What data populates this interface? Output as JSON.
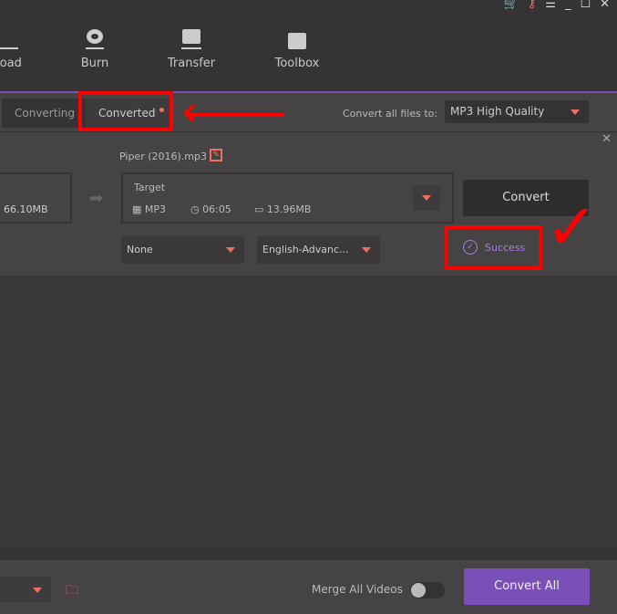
{
  "window_controls": [
    "cart-icon",
    "key-icon",
    "menu-icon",
    "minimize-icon",
    "maximize-icon",
    "close-icon"
  ],
  "nav": [
    {
      "label": "load",
      "icon": "download-icon"
    },
    {
      "label": "Burn",
      "icon": "disc-icon"
    },
    {
      "label": "Transfer",
      "icon": "transfer-icon"
    },
    {
      "label": "Toolbox",
      "icon": "toolbox-icon"
    }
  ],
  "tabs": {
    "converting": "Converting",
    "converted": "Converted"
  },
  "convert_all_label": "Convert all files to:",
  "format_select": "MP3 High Quality",
  "item": {
    "filename": "Piper (2016).mp3",
    "source_size": "66.10MB",
    "target_label": "Target",
    "format": "MP3",
    "duration": "06:05",
    "size": "13.96MB",
    "convert_button": "Convert",
    "subtitle": "None",
    "audio": "English-Advanc...",
    "status": "Success"
  },
  "bottom": {
    "merge_label": "Merge All Videos",
    "merge_on": false,
    "convert_all_button": "Convert All"
  },
  "colors": {
    "accent": "#7b4fb8",
    "icon": "#f07060",
    "annotation": "#ff0000"
  }
}
